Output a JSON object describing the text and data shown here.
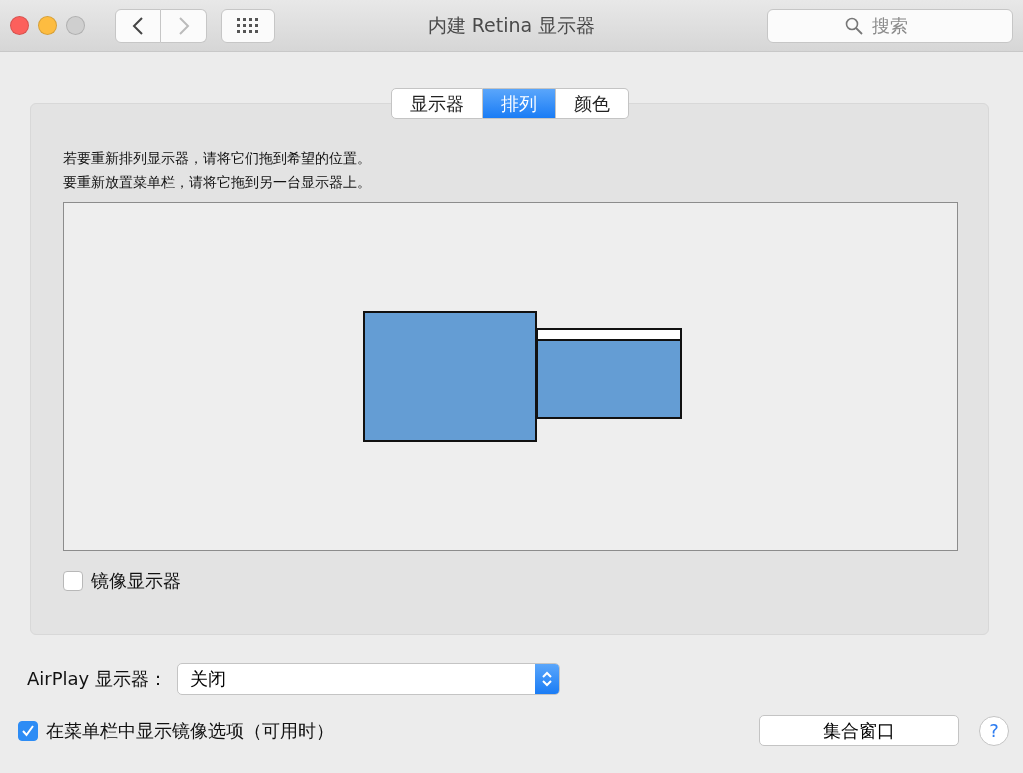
{
  "window": {
    "title": "内建 Retina 显示器",
    "search": {
      "placeholder": "搜索"
    }
  },
  "tabs": [
    {
      "label": "显示器",
      "selected": false
    },
    {
      "label": "排列",
      "selected": true
    },
    {
      "label": "颜色",
      "selected": false
    }
  ],
  "instructions": [
    "若要重新排列显示器，请将它们拖到希望的位置。",
    "要重新放置菜单栏，请将它拖到另一台显示器上。"
  ],
  "displays": [
    {
      "has_menu_bar": false
    },
    {
      "has_menu_bar": true
    }
  ],
  "mirror": {
    "label": "镜像显示器",
    "checked": false
  },
  "airplay": {
    "label": "AirPlay 显示器：",
    "value": "关闭"
  },
  "show_in_menu_bar": {
    "label": "在菜单栏中显示镜像选项（可用时）",
    "checked": true
  },
  "gather_button": "集合窗口",
  "help_button": "?"
}
